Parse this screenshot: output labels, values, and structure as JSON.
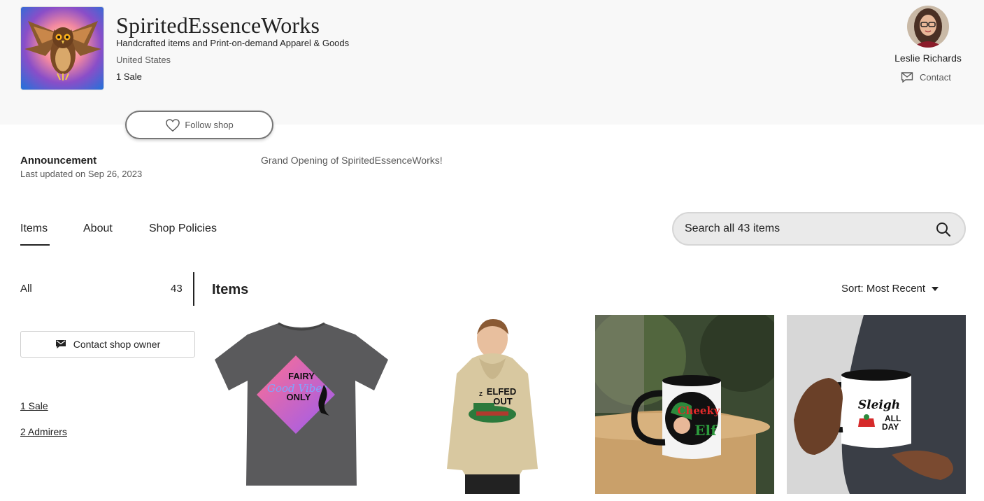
{
  "shop": {
    "name": "SpiritedEssenceWorks",
    "tagline": "Handcrafted items and Print-on-demand Apparel & Goods",
    "location": "United States",
    "sales": "1 Sale",
    "follow_label": "Follow shop",
    "logo_icon": "owl-logo"
  },
  "owner": {
    "name": "Leslie Richards",
    "contact_label": "Contact"
  },
  "announcement": {
    "title": "Announcement",
    "updated": "Last updated on Sep 26, 2023",
    "text": "Grand Opening of SpiritedEssenceWorks!"
  },
  "tabs": [
    {
      "label": "Items",
      "active": true
    },
    {
      "label": "About",
      "active": false
    },
    {
      "label": "Shop Policies",
      "active": false
    }
  ],
  "search": {
    "placeholder": "Search all 43 items"
  },
  "sidebar": {
    "category_label": "All",
    "category_count": "43",
    "contact_owner_label": "Contact shop owner",
    "sales_link": "1 Sale",
    "admirers_link": "2 Admirers"
  },
  "items_section": {
    "heading": "Items",
    "sort_label": "Sort: Most Recent"
  },
  "listings": [
    {
      "name": "fairy-good-vibes-tshirt",
      "print_lines": [
        "FAIRY",
        "Good Vibes",
        "ONLY"
      ]
    },
    {
      "name": "elfed-out-hoodie",
      "print_lines": [
        "ELFED",
        "OUT"
      ]
    },
    {
      "name": "cheeky-elf-mug",
      "print_lines": [
        "Cheeky",
        "Elf"
      ]
    },
    {
      "name": "sleigh-all-day-mug",
      "print_lines": [
        "Sleigh",
        "ALL",
        "DAY"
      ]
    }
  ],
  "colors": {
    "header_bg": "#f8f8f8",
    "text": "#222222",
    "muted": "#595959",
    "search_bg": "#eaeaea"
  }
}
